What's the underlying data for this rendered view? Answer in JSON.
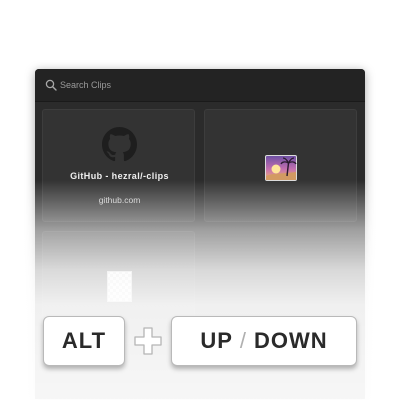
{
  "search": {
    "placeholder": "Search Clips",
    "icon": "search-icon"
  },
  "clips": [
    {
      "type": "link",
      "icon": "github-icon",
      "title": "GitHub - hezral/-clips",
      "subtitle": "github.com"
    },
    {
      "type": "image",
      "icon": "image-icon"
    },
    {
      "type": "file",
      "icon": "document-icon"
    }
  ],
  "shortcut": {
    "modifier": "ALT",
    "key_up": "UP",
    "separator": "/",
    "key_down": "DOWN",
    "plus_icon": "plus-icon"
  },
  "colors": {
    "window_bg": "#2b2b2b",
    "searchbar_bg": "#232323",
    "card_bg": "#333333",
    "key_text": "#2a2a2a"
  }
}
